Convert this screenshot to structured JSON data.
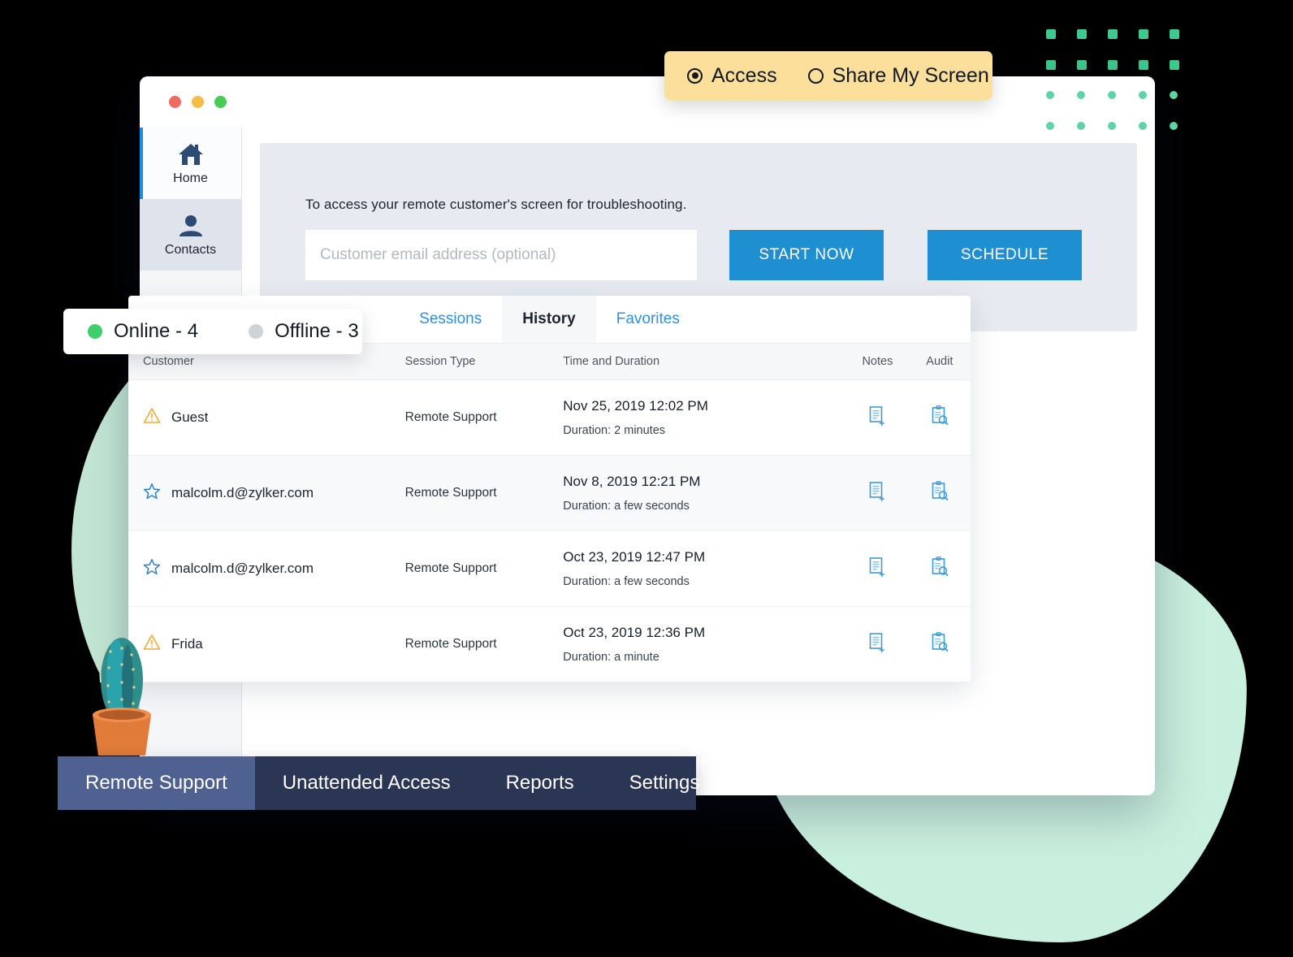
{
  "access_toggle": {
    "options": [
      {
        "label": "Access",
        "selected": true,
        "icon": "radio-selected-icon"
      },
      {
        "label": "Share My Screen",
        "selected": false,
        "icon": "radio-unselected-icon"
      }
    ]
  },
  "window": {
    "traffic_lights": [
      "close",
      "minimize",
      "maximize"
    ]
  },
  "sidebar": {
    "items": [
      {
        "label": "Home",
        "icon": "home-icon",
        "active": true
      },
      {
        "label": "Contacts",
        "icon": "person-icon",
        "active": false
      }
    ]
  },
  "access_panel": {
    "description": "To access your remote customer's screen for troubleshooting.",
    "email_placeholder": "Customer email address (optional)",
    "email_value": "",
    "start_label": "START NOW",
    "schedule_label": "SCHEDULE"
  },
  "status_pill": {
    "online": {
      "label": "Online - 4",
      "color": "#3ece6b"
    },
    "offline": {
      "label": "Offline - 3",
      "color": "#cfd2d6"
    }
  },
  "history_card": {
    "tabs": [
      {
        "label": "Sessions",
        "active": false
      },
      {
        "label": "History",
        "active": true
      },
      {
        "label": "Favorites",
        "active": false
      }
    ],
    "columns": [
      "Customer",
      "Session Type",
      "Time and Duration",
      "Notes",
      "Audit"
    ],
    "rows": [
      {
        "status_icon": "warning-triangle-icon",
        "customer": "Guest",
        "session_type": "Remote Support",
        "time": "Nov 25, 2019 12:02 PM",
        "duration": "Duration: 2 minutes",
        "notes_icon": "note-add-icon",
        "audit_icon": "audit-search-icon"
      },
      {
        "status_icon": "star-outline-icon",
        "customer": "malcolm.d@zylker.com",
        "session_type": "Remote Support",
        "time": "Nov 8, 2019 12:21 PM",
        "duration": "Duration: a few seconds",
        "notes_icon": "note-add-icon",
        "audit_icon": "audit-search-icon"
      },
      {
        "status_icon": "star-outline-icon",
        "customer": "malcolm.d@zylker.com",
        "session_type": "Remote Support",
        "time": "Oct 23, 2019 12:47 PM",
        "duration": "Duration: a few seconds",
        "notes_icon": "note-add-icon",
        "audit_icon": "audit-search-icon"
      },
      {
        "status_icon": "warning-triangle-icon",
        "customer": "Frida",
        "session_type": "Remote Support",
        "time": "Oct 23, 2019 12:36 PM",
        "duration": "Duration: a minute",
        "notes_icon": "note-add-icon",
        "audit_icon": "audit-search-icon"
      }
    ]
  },
  "bottom_nav": {
    "items": [
      {
        "label": "Remote Support",
        "active": true
      },
      {
        "label": "Unattended Access",
        "active": false
      },
      {
        "label": "Reports",
        "active": false
      },
      {
        "label": "Settings",
        "active": false
      }
    ]
  },
  "colors": {
    "accent_blue": "#1e8fd0",
    "tab_link_blue": "#2f8fdd",
    "nav_dark": "#2b3654",
    "nav_active": "#4f6191",
    "toggle_yellow": "#fbdf9b",
    "mint_blob": "#c9f0de",
    "dot_green": "#3dc98f",
    "warning_orange": "#f0a934",
    "star_blue": "#2f80c4",
    "panel_gray": "#e7eaf0"
  }
}
